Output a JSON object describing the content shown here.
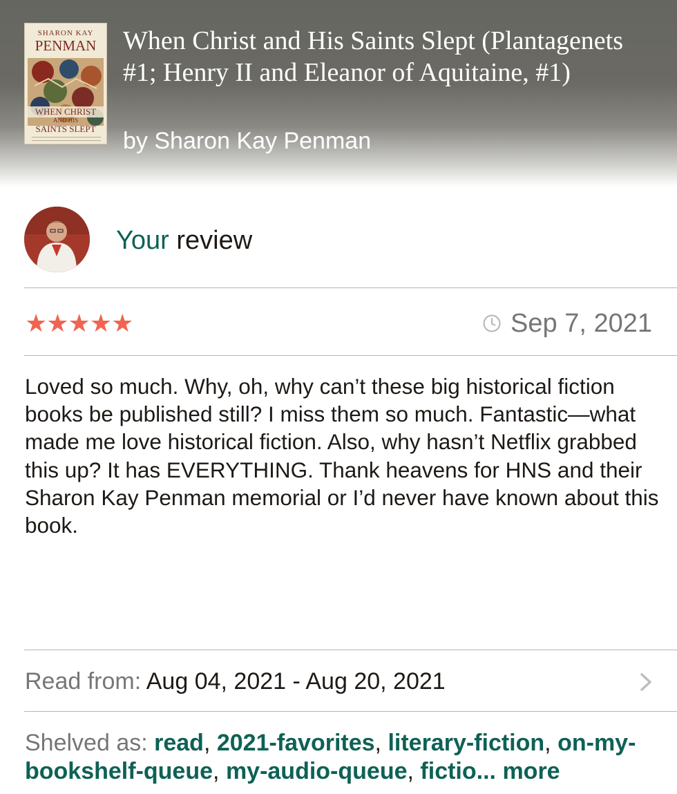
{
  "book": {
    "title": "When Christ and His Saints Slept (Plantagenets #1; Henry II and Eleanor of Aquitaine, #1)",
    "author_line": "by Sharon Kay Penman",
    "cover": {
      "author_small": "SHARON KAY",
      "author_large": "PENMAN",
      "title_line1": "WHEN CHRIST",
      "title_line2": "AND HIS",
      "title_line3": "SAINTS SLEPT"
    }
  },
  "review": {
    "heading_highlight": "Your",
    "heading_rest": " review",
    "rating": 5,
    "stars": "★★★★★",
    "date": "Sep 7, 2021",
    "body": "Loved so much. Why, oh, why can’t these big historical fiction books be published still? I miss them so much. Fantastic—what made me love historical fiction. Also, why hasn’t Netflix grabbed this up? It has EVERYTHING. Thank heavens for HNS and their Sharon Kay Penman memorial or I’d never have known about this book."
  },
  "reading": {
    "label": "Read from: ",
    "range": "Aug 04, 2021 - Aug 20, 2021"
  },
  "shelves": {
    "label": "Shelved as: ",
    "tags": [
      "read",
      "2021-favorites",
      "literary-fiction",
      "on-my-bookshelf-queue",
      "my-audio-queue",
      "fictio..."
    ],
    "more_label": "more"
  },
  "colors": {
    "accent_green": "#0e6155",
    "star_color": "#f06451",
    "muted_text": "#767676"
  }
}
